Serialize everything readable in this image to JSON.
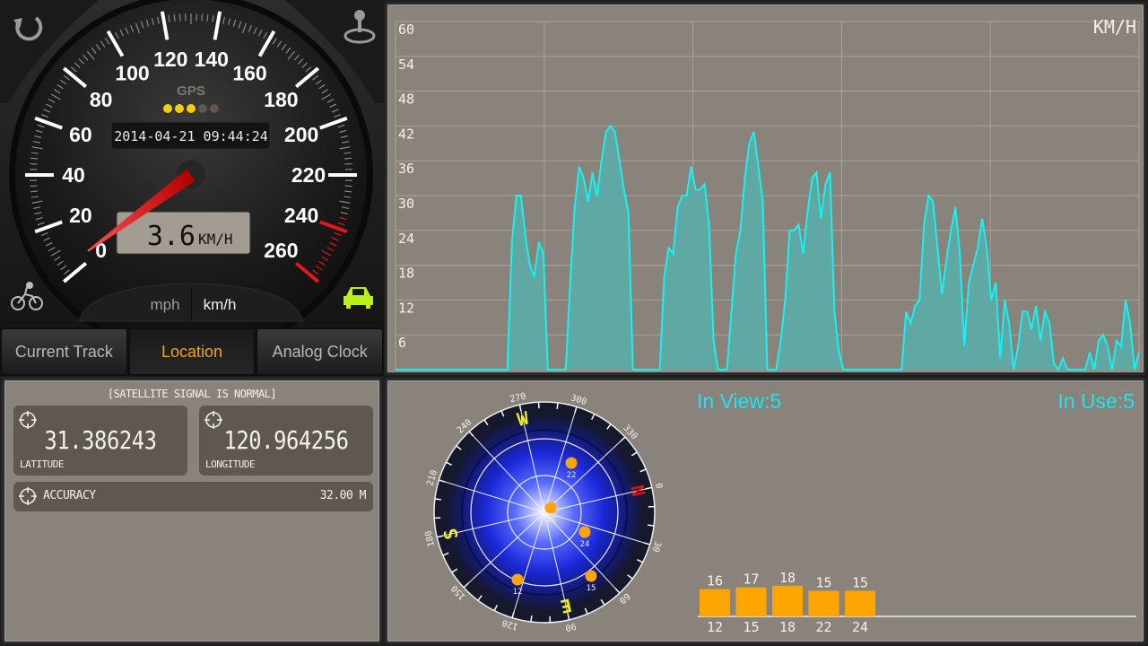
{
  "speedometer": {
    "scale_labels": [
      "0",
      "20",
      "40",
      "60",
      "80",
      "100",
      "120",
      "140",
      "160",
      "180",
      "200",
      "220",
      "240",
      "260"
    ],
    "gps_label": "GPS",
    "gps_signal_dots": {
      "lit": 3,
      "total": 5
    },
    "datetime": "2014-04-21 09:44:24",
    "speed_value": "3.6",
    "speed_unit": "KM/H",
    "speed": 3.6,
    "unit_toggle": {
      "mph": "mph",
      "kmh": "km/h",
      "selected": "km/h"
    },
    "icons": {
      "top_left": "refresh-icon",
      "top_right": "joystick-icon",
      "bottom_left": "bicycle-icon",
      "bottom_right": "car-icon"
    },
    "mode_active_color": "#b8f01a"
  },
  "tabs": [
    {
      "label": "Current Track",
      "active": false
    },
    {
      "label": "Location",
      "active": true
    },
    {
      "label": "Analog Clock",
      "active": false
    }
  ],
  "location": {
    "status": "[SATELLITE SIGNAL IS NORMAL]",
    "latitude": {
      "value": "31.386243",
      "label": "LATITUDE"
    },
    "longitude": {
      "value": "120.964256",
      "label": "LONGITUDE"
    },
    "accuracy": {
      "label": "ACCURACY",
      "value": "32.00 M"
    }
  },
  "chart_data": {
    "type": "area",
    "unit_label": "KM/H",
    "ylim": [
      0,
      60
    ],
    "yticks": [
      "60",
      "54",
      "48",
      "42",
      "36",
      "30",
      "24",
      "18",
      "12",
      "6"
    ],
    "grid": true,
    "x_divisions": 5,
    "line_color": "#19f0f0",
    "fill_color": "#5fa8a4",
    "values": [
      0,
      0,
      0,
      0,
      0,
      0,
      0,
      0,
      0,
      0,
      0,
      0,
      0,
      0,
      0,
      0,
      0,
      0,
      0,
      0,
      0,
      0,
      0,
      0,
      0,
      0,
      22,
      30,
      30,
      23,
      18,
      16,
      22,
      20,
      0,
      0,
      0,
      0,
      0,
      15,
      28,
      35,
      33,
      29,
      34,
      30,
      36,
      41,
      42,
      41,
      36,
      31,
      27,
      0,
      0,
      0,
      0,
      0,
      0,
      0,
      16,
      21,
      20,
      28,
      30,
      30,
      35,
      31,
      31,
      32,
      25,
      5,
      0,
      0,
      0,
      10,
      20,
      24,
      33,
      39,
      41,
      35,
      29,
      0,
      0,
      0,
      5,
      12,
      24,
      24,
      25,
      20,
      27,
      33,
      34,
      26,
      32,
      34,
      10,
      3,
      0,
      0,
      0,
      0,
      0,
      0,
      0,
      0,
      0,
      0,
      0,
      0,
      0,
      0,
      10,
      8,
      11,
      12,
      25,
      30,
      29,
      21,
      13,
      19,
      24,
      28,
      20,
      4,
      15,
      18,
      21,
      26,
      21,
      12,
      15,
      2,
      12,
      8,
      0,
      4,
      10,
      10,
      7,
      11,
      5,
      10,
      8,
      1,
      0,
      2,
      0,
      0,
      0,
      0,
      0,
      3,
      0,
      5,
      6,
      4,
      0,
      5,
      4,
      12,
      8,
      0,
      3
    ]
  },
  "satellites": {
    "in_view": "In View:5",
    "in_use": "In Use:5",
    "compass_degrees": [
      "0",
      "30",
      "60",
      "90",
      "120",
      "150",
      "180",
      "210",
      "240",
      "270",
      "300",
      "330"
    ],
    "cardinals": [
      {
        "label": "N",
        "deg": 0,
        "color": "#e01010"
      },
      {
        "label": "E",
        "deg": 90,
        "color": "#f0f020"
      },
      {
        "label": "S",
        "deg": 180,
        "color": "#f0f020"
      },
      {
        "label": "W",
        "deg": 270,
        "color": "#f0f020"
      }
    ],
    "sky_ids": [
      "22",
      "18",
      "24",
      "15",
      "12"
    ],
    "bars": [
      {
        "prn": "12",
        "snr": 16
      },
      {
        "prn": "15",
        "snr": 17
      },
      {
        "prn": "18",
        "snr": 18
      },
      {
        "prn": "22",
        "snr": 15
      },
      {
        "prn": "24",
        "snr": 15
      }
    ],
    "bar_color": "#ffa500",
    "dot_color": "#ffa500"
  }
}
